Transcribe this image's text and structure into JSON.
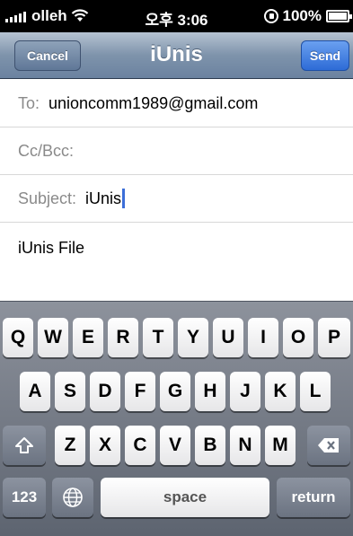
{
  "status_bar": {
    "carrier": "olleh",
    "time": "오후 3:06",
    "battery_percent": "100%",
    "battery_level": 1.0
  },
  "nav": {
    "cancel_label": "Cancel",
    "title": "iUnis",
    "send_label": "Send"
  },
  "fields": {
    "to_label": "To:",
    "to_value": "unioncomm1989@gmail.com",
    "cc_label": "Cc/Bcc:",
    "subject_label": "Subject:",
    "subject_value": "iUnis"
  },
  "body": {
    "text": "iUnis File"
  },
  "keyboard": {
    "row1": [
      "Q",
      "W",
      "E",
      "R",
      "T",
      "Y",
      "U",
      "I",
      "O",
      "P"
    ],
    "row2": [
      "A",
      "S",
      "D",
      "F",
      "G",
      "H",
      "J",
      "K",
      "L"
    ],
    "row3": [
      "Z",
      "X",
      "C",
      "V",
      "B",
      "N",
      "M"
    ],
    "numbers_label": "123",
    "space_label": "space",
    "return_label": "return",
    "shift_icon": "shift-icon",
    "backspace_icon": "backspace-icon",
    "globe_icon": "globe-icon"
  }
}
